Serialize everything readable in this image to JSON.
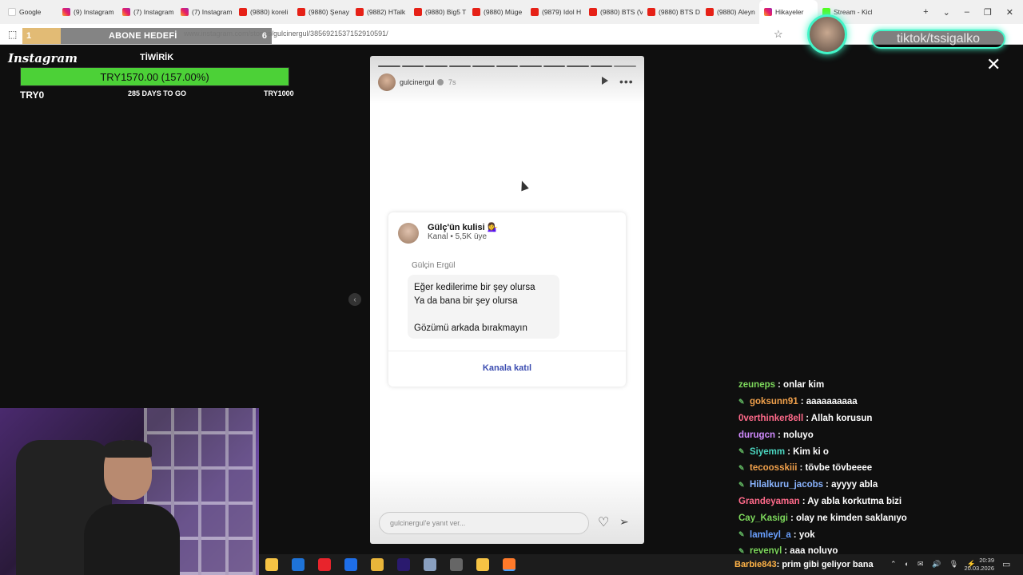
{
  "browser": {
    "tabs": [
      {
        "label": "Google",
        "icon": "google-icon",
        "w": 68
      },
      {
        "label": "(9) Instagram",
        "icon": "instagram-icon",
        "w": 75
      },
      {
        "label": "(7) Instagram",
        "icon": "instagram-icon",
        "w": 73
      },
      {
        "label": "(7) Instagram",
        "icon": "instagram-icon",
        "w": 73
      },
      {
        "label": "(9880) koreli",
        "icon": "youtube-icon",
        "w": 73
      },
      {
        "label": "(9880) Şenay",
        "icon": "youtube-icon",
        "w": 73
      },
      {
        "label": "(9882) HTalk",
        "icon": "youtube-icon",
        "w": 73
      },
      {
        "label": "(9880) Big5 T",
        "icon": "youtube-icon",
        "w": 73
      },
      {
        "label": "(9880) Müge",
        "icon": "youtube-icon",
        "w": 73
      },
      {
        "label": "(9879) Idol H",
        "icon": "youtube-icon",
        "w": 73
      },
      {
        "label": "(9880) BTS (V",
        "icon": "youtube-icon",
        "w": 73
      },
      {
        "label": "(9880) BTS D",
        "icon": "youtube-icon",
        "w": 73
      },
      {
        "label": "(9880) Aleyn",
        "icon": "youtube-icon",
        "w": 73
      },
      {
        "label": "Hikayeler",
        "icon": "instagram-icon",
        "w": 73,
        "active": true
      },
      {
        "label": "Stream - Kick",
        "icon": "kick-icon",
        "w": 68
      }
    ],
    "url": "www.instagram.com/stories/gulcinergul/3856921537152910591/"
  },
  "abone_goal": {
    "current": "1",
    "label": "ABONE HEDEFİ",
    "target": "6"
  },
  "goal": {
    "logo": "Instagram",
    "title": "TİWİRİK",
    "text": "TRY1570.00 (157.00%)",
    "min": "TRY0",
    "days": "285 DAYS TO GO",
    "max": "TRY1000",
    "progress_fraction": 1.0,
    "color": "#4cd137"
  },
  "story": {
    "username": "gulcinergul",
    "time": "7s",
    "segments_total": 11,
    "segments_done": 10,
    "channel": {
      "name": "Gülç'ün kulisi 💁‍♀️",
      "meta": "Kanal  •  5,5K üye",
      "author": "Gülçin Ergül",
      "message": [
        "Eğer kedilerime bir şey olursa",
        "Ya da bana bir şey olursa",
        "",
        "Gözümü arkada bırakmayın"
      ],
      "join": "Kanala katıl"
    },
    "reply_placeholder": "gulcinergul'e yanıt ver..."
  },
  "tiktok": "tiktok/tssigalko",
  "chat": [
    {
      "user": "zeuneps",
      "color": "#7dd85c",
      "msg": ": onlar kim",
      "badge": false
    },
    {
      "user": "goksunn91",
      "color": "#f0a04b",
      "msg": ": aaaaaaaaaa",
      "badge": true
    },
    {
      "user": "0verthinker8ell",
      "color": "#ff6a8a",
      "msg": ": Allah korusun",
      "badge": false
    },
    {
      "user": "durugcn",
      "color": "#d18bff",
      "msg": ": noluyo",
      "badge": false
    },
    {
      "user": "Siyemm",
      "color": "#4bd6c0",
      "msg": ": Kim ki o",
      "badge": true
    },
    {
      "user": "tecoosskiii",
      "color": "#f0a04b",
      "msg": ": tövbe tövbeeee",
      "badge": true
    },
    {
      "user": "Hilalkuru_jacobs",
      "color": "#8ab4ff",
      "msg": ": ayyyy abla",
      "badge": true
    },
    {
      "user": "Grandeyaman",
      "color": "#ff6a8a",
      "msg": ": Ay abla korkutma bizi",
      "badge": false
    },
    {
      "user": "Cay_Kasigi",
      "color": "#7dd85c",
      "msg": ": olay ne kimden saklanıyo",
      "badge": false
    },
    {
      "user": "lamleyl_a",
      "color": "#6aa0ff",
      "msg": ": yok",
      "badge": true
    },
    {
      "user": "revenyl",
      "color": "#7dd85c",
      "msg": ": aaa noluyo",
      "badge": true
    }
  ],
  "taskbar": {
    "ticker_user": "Barbie843",
    "ticker_msg": ": prim gibi geliyor bana",
    "time": "20:39",
    "date": "20.03.2026",
    "icons": [
      {
        "name": "file-explorer-icon",
        "color": "#f6c344"
      },
      {
        "name": "outlook-icon",
        "color": "#1e73d8"
      },
      {
        "name": "opera-icon",
        "color": "#e8242c"
      },
      {
        "name": "dropbox-icon",
        "color": "#1e6ee8"
      },
      {
        "name": "chrome-icon",
        "color": "#e9b53a"
      },
      {
        "name": "premiere-icon",
        "color": "#2a1a6e"
      },
      {
        "name": "app-icon",
        "color": "#8aa0c0"
      },
      {
        "name": "obs-icon",
        "color": "#666"
      },
      {
        "name": "folder-icon",
        "color": "#f6c344"
      },
      {
        "name": "firefox-icon",
        "color": "#ff7a2a",
        "active": true
      }
    ]
  }
}
